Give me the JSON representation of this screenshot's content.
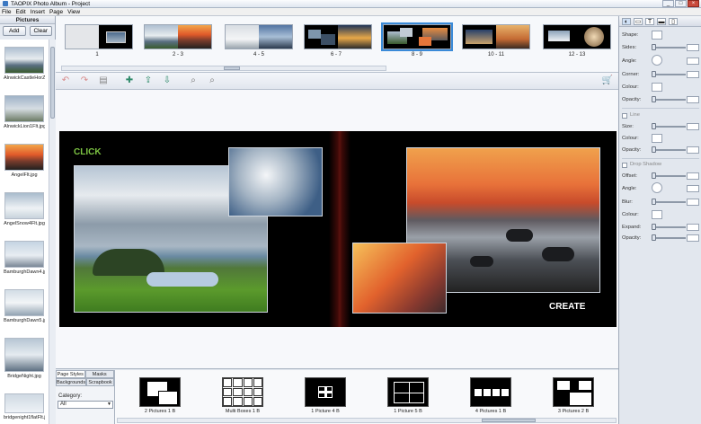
{
  "window": {
    "title": "TAOPIX Photo Album - Project",
    "min": "_",
    "max": "□",
    "close": "×"
  },
  "menu": [
    "File",
    "Edit",
    "Insert",
    "Page",
    "View"
  ],
  "pictures_panel": {
    "title": "Pictures",
    "add_label": "Add",
    "clear_label": "Clear",
    "items": [
      {
        "label": "AlnwickCastleHorZ..."
      },
      {
        "label": "AlnwickLion1Flt.jpg"
      },
      {
        "label": "AngelFlt.jpg"
      },
      {
        "label": "AngelSnow4Flt.jpg"
      },
      {
        "label": "BamburghDawn4.jpg"
      },
      {
        "label": "BamburghDawn5.jpg"
      },
      {
        "label": "BridgeNight.jpg"
      },
      {
        "label": "bridgenight1flatFlt.jpg"
      }
    ]
  },
  "filmstrip": {
    "spreads": [
      {
        "label": "1"
      },
      {
        "label": "2 - 3"
      },
      {
        "label": "4 - 5"
      },
      {
        "label": "6 - 7"
      },
      {
        "label": "8 - 9",
        "selected": true
      },
      {
        "label": "10 - 11"
      },
      {
        "label": "12 - 13"
      }
    ]
  },
  "toolbar": {
    "icons": [
      "undo-icon",
      "redo-icon",
      "delete-icon",
      "add-page-icon",
      "insert-page-icon",
      "remove-page-icon",
      "zoom-in-icon",
      "zoom-out-icon",
      "cart-icon"
    ]
  },
  "spread_text": {
    "left": "CLICK",
    "right": "CREATE",
    "left_color": "#7dc443",
    "right_color": "#ffffff"
  },
  "bottom": {
    "tabs": {
      "page_styles": "Page Styles",
      "masks": "Masks",
      "backgrounds": "Backgrounds",
      "scrapbook": "Scrapbook"
    },
    "category_label": "Category:",
    "category_value": "All",
    "layouts": [
      {
        "label": "2 Pictures 1 B"
      },
      {
        "label": "Multi Boxes 1 B"
      },
      {
        "label": "1 Picture 4 B"
      },
      {
        "label": "1 Picture 5 B"
      },
      {
        "label": "4 Pictures 1 B"
      },
      {
        "label": "3 Pictures 2 B"
      }
    ]
  },
  "properties": {
    "shape": "Shape:",
    "sides": "Sides:",
    "angle": "Angle:",
    "corner": "Corner:",
    "colour": "Colour:",
    "opacity": "Opacity:",
    "line": "Line",
    "size": "Size:",
    "shadow": "Drop Shadow",
    "offset": "Offset:",
    "blur": "Blur:",
    "expand": "Expand:"
  }
}
